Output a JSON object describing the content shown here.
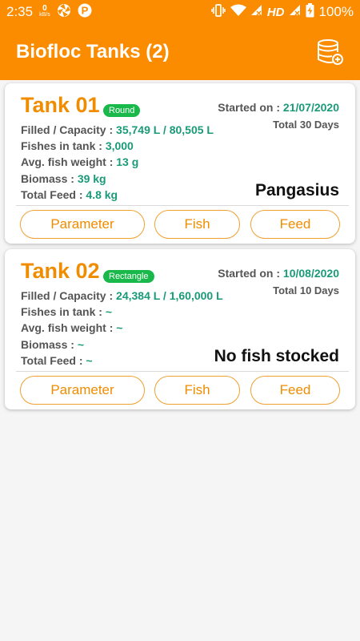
{
  "status_bar": {
    "time": "2:35",
    "net_speed_value": "0",
    "net_speed_unit": "kB/s",
    "hd_label": "HD",
    "battery_percent": "100%"
  },
  "app_bar": {
    "title": "Biofloc Tanks (2)",
    "action_icon": "database-add-icon"
  },
  "labels": {
    "filled_capacity": "Filled / Capacity : ",
    "fishes_in_tank": "Fishes in tank : ",
    "avg_fish_weight": "Avg. fish weight : ",
    "biomass": "Biomass : ",
    "total_feed": "Total Feed : ",
    "started_on": "Started on : ",
    "btn_parameter": "Parameter",
    "btn_fish": "Fish",
    "btn_feed": "Feed"
  },
  "tanks": [
    {
      "name": "Tank 01",
      "shape": "Round",
      "started_on": "21/07/2020",
      "total_days": "Total 30 Days",
      "filled_capacity": "35,749 L / 80,505 L",
      "fishes_in_tank": "3,000",
      "avg_fish_weight": "13 g",
      "biomass": "39 kg",
      "total_feed": "4.8 kg",
      "species": "Pangasius"
    },
    {
      "name": "Tank 02",
      "shape": "Rectangle",
      "started_on": "10/08/2020",
      "total_days": "Total 10 Days",
      "filled_capacity": "24,384 L / 1,60,000 L",
      "fishes_in_tank": "~",
      "avg_fish_weight": "~",
      "biomass": "~",
      "total_feed": "~",
      "species": "No fish stocked"
    }
  ],
  "colors": {
    "primary": "#fb8c00",
    "accent_text": "#f08c00",
    "value_green": "#1a9a78",
    "badge_green": "#19b84a"
  }
}
